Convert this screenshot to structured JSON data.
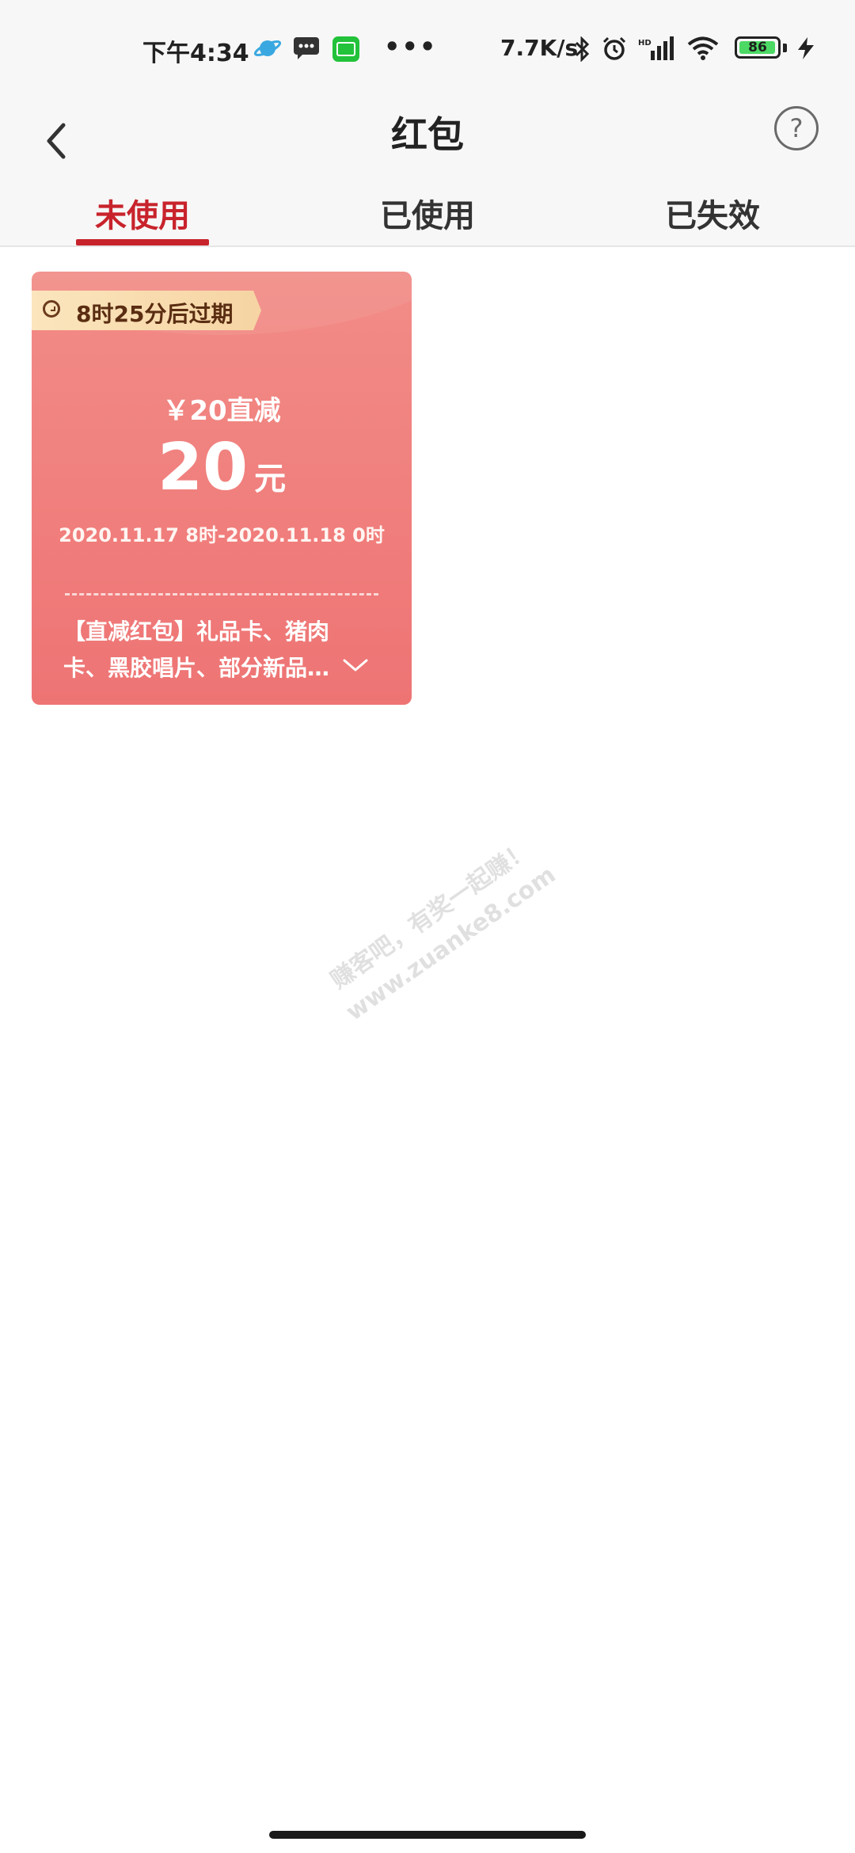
{
  "status_bar": {
    "time": "下午4:34",
    "dots": "•••",
    "network_speed": "7.7K/s",
    "battery_level": "86",
    "icons": [
      "planet-icon",
      "message-icon",
      "iqiyi-icon",
      "bluetooth-icon",
      "alarm-icon",
      "signal-icon",
      "wifi-icon",
      "battery-icon",
      "charging-icon"
    ]
  },
  "header": {
    "title": "红包",
    "help_symbol": "?"
  },
  "tabs": [
    {
      "label": "未使用",
      "active": true
    },
    {
      "label": "已使用",
      "active": false
    },
    {
      "label": "已失效",
      "active": false
    }
  ],
  "coupon": {
    "expire_text": "8时25分后过期",
    "label": "￥20直减",
    "amount": "20",
    "unit": "元",
    "period": "2020.11.17  8时-2020.11.18  0时",
    "description": "【直减红包】礼品卡、猪肉卡、黑胶唱片、部分新品…",
    "colors": {
      "top": "#f28c87",
      "bottom": "#ee7474",
      "tag": "#fbe5bd"
    }
  },
  "watermark": {
    "line1": "赚客吧，有奖一起赚！",
    "line2": "www.zuanke8.com"
  },
  "colors": {
    "accent": "#c8232c"
  }
}
